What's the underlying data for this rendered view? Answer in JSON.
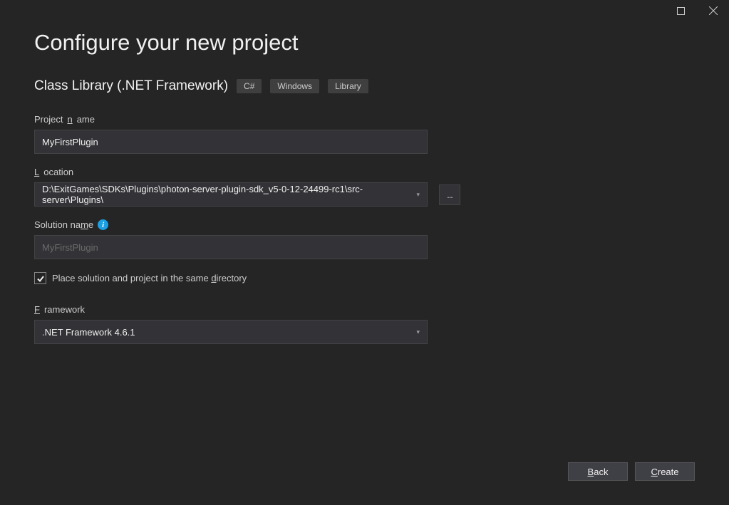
{
  "titlebar": {},
  "header": {
    "title": "Configure your new project",
    "subtitle": "Class Library (.NET Framework)",
    "tags": [
      "C#",
      "Windows",
      "Library"
    ]
  },
  "fields": {
    "project_name_label": "Project name",
    "project_name_value": "MyFirstPlugin",
    "location_label": "Location",
    "location_value": "D:\\ExitGames\\SDKs\\Plugins\\photon-server-plugin-sdk_v5-0-12-24499-rc1\\src-server\\Plugins\\",
    "browse_label": "...",
    "solution_name_label": "Solution name",
    "solution_name_placeholder": "MyFirstPlugin",
    "same_dir_checkbox_label": "Place solution and project in the same directory",
    "same_dir_checked": true,
    "framework_label": "Framework",
    "framework_value": ".NET Framework 4.6.1"
  },
  "footer": {
    "back_label": "Back",
    "create_label": "Create"
  }
}
